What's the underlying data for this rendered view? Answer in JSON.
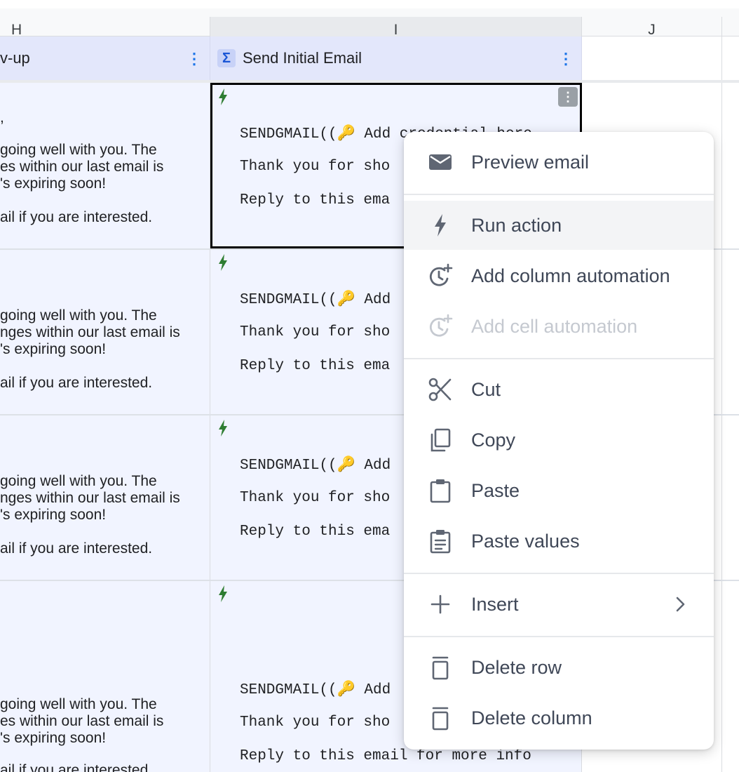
{
  "column_letters": [
    "H",
    "I",
    "J"
  ],
  "header": {
    "h_label": "v-up",
    "i_label": "Send Initial Email",
    "sigma_icon": "Σ",
    "kebab_icon": "⋮"
  },
  "rows": [
    {
      "h_lines": [
        ",",
        "going well with you. The",
        "es within our last email is",
        "'s expiring soon!",
        "ail if you are interested."
      ],
      "i_lines": [
        "SENDGMAIL((🔑 Add credential here",
        "Thank you for sho",
        "Reply to this ema"
      ]
    },
    {
      "h_lines": [
        "going well with you. The",
        "nges within our last email is",
        "'s expiring soon!",
        "ail if you are interested."
      ],
      "i_lines": [
        "SENDGMAIL((🔑 Add",
        "Thank you for sho",
        "Reply to this ema"
      ]
    },
    {
      "h_lines": [
        "going well with you. The",
        "nges within our last email is",
        "'s expiring soon!",
        "ail if you are interested."
      ],
      "i_lines": [
        "SENDGMAIL((🔑 Add",
        "Thank you for sho",
        "Reply to this ema"
      ]
    },
    {
      "h_lines": [
        "going well with you. The",
        "es within our last email is",
        "'s expiring soon!",
        "ail if you are interested."
      ],
      "i_lines": [
        "SENDGMAIL((🔑 Add",
        "Thank you for sho",
        "Reply to this email for more info"
      ]
    }
  ],
  "context_menu": {
    "items": [
      {
        "label": "Preview email",
        "icon": "envelope-icon"
      },
      {
        "label": "Run action",
        "icon": "lightning-icon"
      },
      {
        "label": "Add column automation",
        "icon": "clock-plus-icon"
      },
      {
        "label": "Add cell automation",
        "icon": "clock-plus-icon"
      },
      {
        "label": "Cut",
        "icon": "scissors-icon"
      },
      {
        "label": "Copy",
        "icon": "copy-icon"
      },
      {
        "label": "Paste",
        "icon": "clipboard-icon"
      },
      {
        "label": "Paste values",
        "icon": "clipboard-list-icon"
      },
      {
        "label": "Insert",
        "icon": "plus-icon"
      },
      {
        "label": "Delete row",
        "icon": "trash-icon"
      },
      {
        "label": "Delete column",
        "icon": "trash-icon"
      }
    ],
    "hovered": "Run action",
    "disabled": [
      "Add cell automation"
    ]
  },
  "colors": {
    "header_bg": "#e3e7fb",
    "cell_bg": "#f1f4ff",
    "bolt": "#2e7d32",
    "accent": "#1a73e8"
  }
}
